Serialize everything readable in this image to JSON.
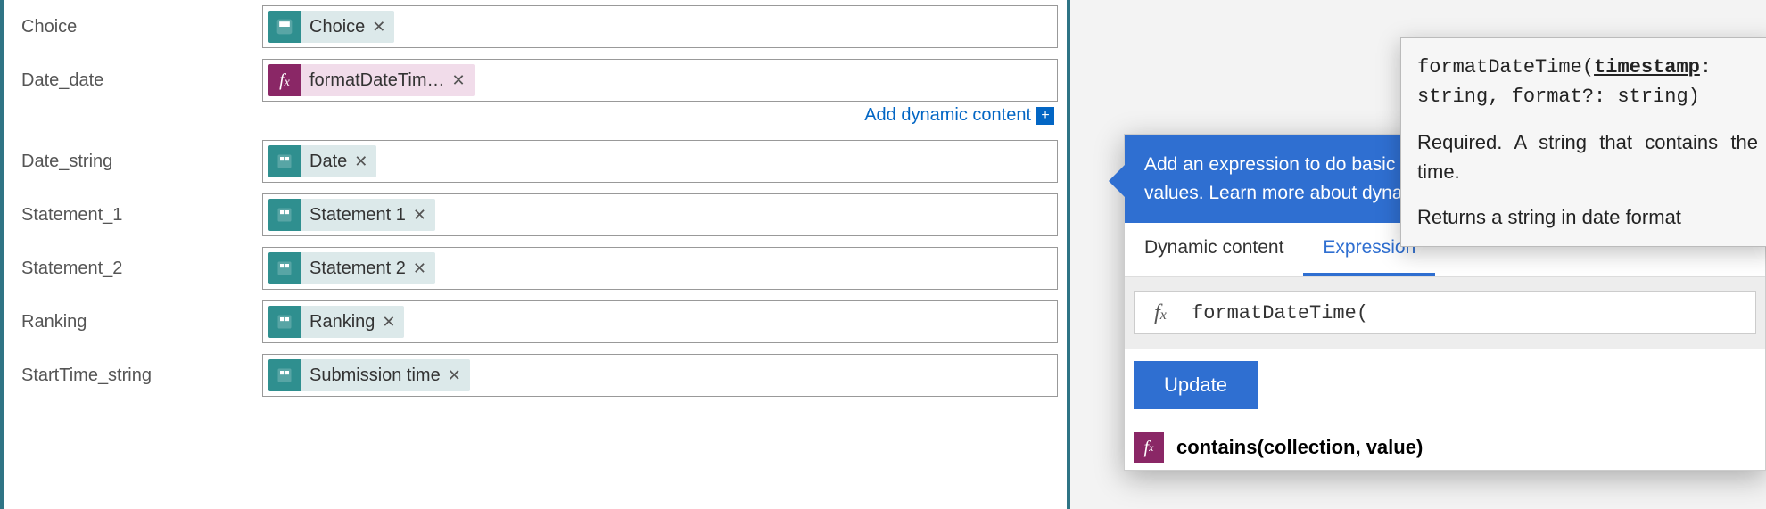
{
  "form": {
    "rows": [
      {
        "label": "Choice",
        "token_type": "teal",
        "token_text": "Choice"
      },
      {
        "label": "Date_date",
        "token_type": "purple",
        "token_text": "formatDateTim…",
        "add_link": true
      },
      {
        "label": "Date_string",
        "token_type": "teal",
        "token_text": "Date"
      },
      {
        "label": "Statement_1",
        "token_type": "teal",
        "token_text": "Statement 1"
      },
      {
        "label": "Statement_2",
        "token_type": "teal",
        "token_text": "Statement 2"
      },
      {
        "label": "Ranking",
        "token_type": "teal",
        "token_text": "Ranking"
      },
      {
        "label": "StartTime_string",
        "token_type": "teal",
        "token_text": "Submission time"
      }
    ],
    "add_dynamic_label": "Add dynamic content",
    "token_close": "✕"
  },
  "picker": {
    "header": "Add an expression to do basic things like access, convert, and compare values. Learn more about dynamic content.",
    "tabs": {
      "dynamic": "Dynamic content",
      "expression": "Expression"
    },
    "expr_input_value": "formatDateTime(",
    "fx_label": "fx",
    "update_label": "Update",
    "fn_listed": "contains(collection, value)"
  },
  "tooltip": {
    "sig_fn": "formatDateTime",
    "sig_p1": "timestamp",
    "sig_rest": ": string, format?: string)",
    "required_note": "Required. A string that contains the time.",
    "returns_note": "Returns a string in date format"
  }
}
